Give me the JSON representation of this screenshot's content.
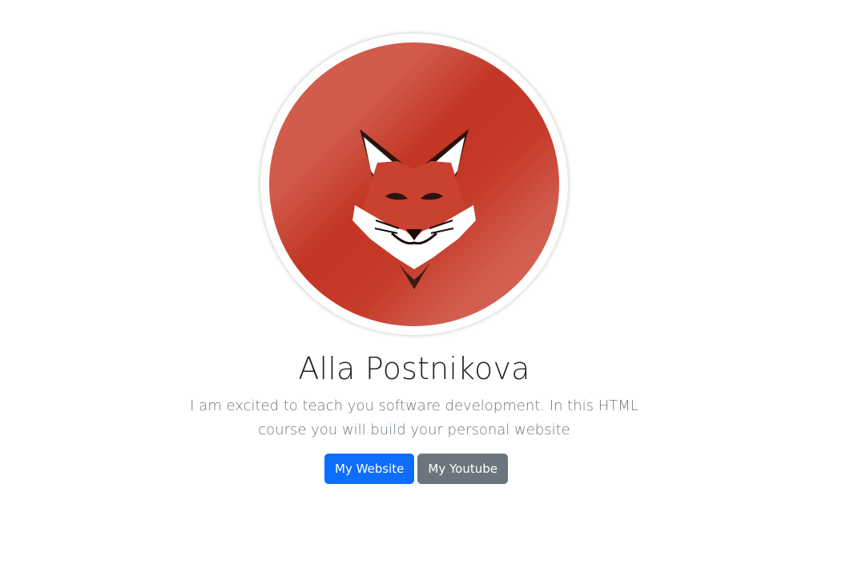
{
  "profile": {
    "name": "Alla Postnikova",
    "bio": "I am excited to teach you software development. In this HTML course you will build your personal website",
    "avatar_icon": "fox-logo-icon"
  },
  "buttons": {
    "website_label": "My Website",
    "youtube_label": "My Youtube"
  },
  "colors": {
    "avatar_red": "#c93a2a",
    "primary": "#0d6efd",
    "secondary": "#6c757d",
    "title": "#212529",
    "muted": "#6c757d"
  }
}
